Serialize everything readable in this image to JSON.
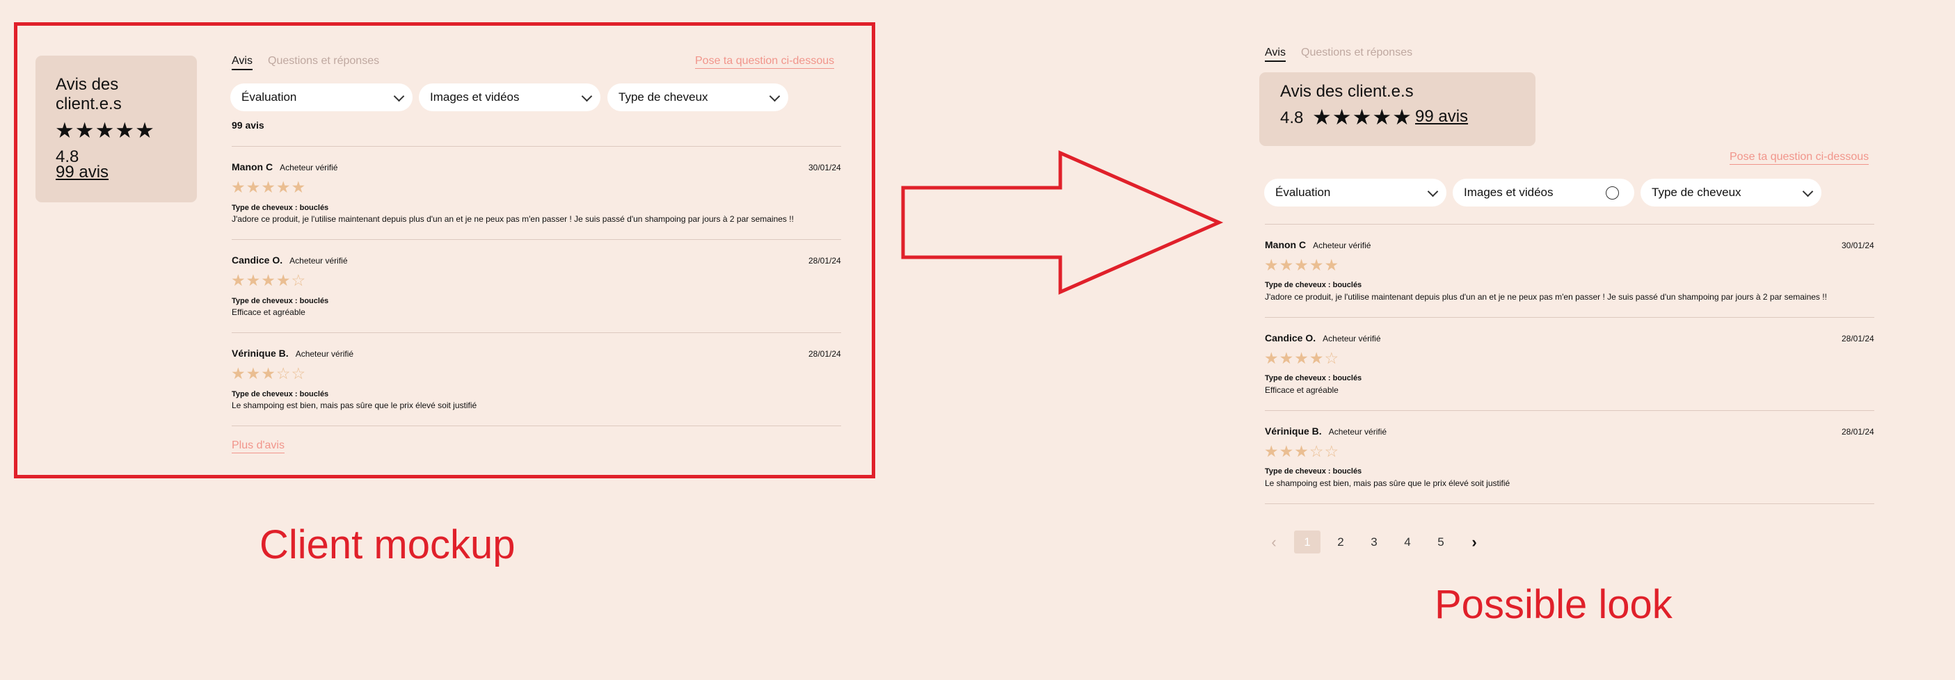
{
  "mockup": {
    "summary": {
      "title_line1": "Avis des",
      "title_line2": "client.e.s",
      "stars": "★★★★★",
      "rating": "4.8",
      "count": "99 avis"
    },
    "tabs": [
      {
        "label": "Avis"
      },
      {
        "label": "Questions et réponses"
      }
    ],
    "ask_link": "Pose ta question ci-dessous",
    "filters": [
      {
        "label": "Évaluation"
      },
      {
        "label": "Images et vidéos"
      },
      {
        "label": "Type de cheveux"
      }
    ],
    "review_count": "99 avis",
    "reviews": [
      {
        "name": "Manon C",
        "verified": "Acheteur vérifié",
        "date": "30/01/24",
        "filled": "★★★★★",
        "empty": "",
        "rating": 5,
        "hair_type": "Type de cheveux : bouclés",
        "text": "J'adore ce produit, je l'utilise maintenant depuis plus d'un an et je ne peux pas m'en passer ! Je suis passé d'un shampoing par jours à 2 par semaines !!"
      },
      {
        "name": "Candice O.",
        "verified": "Acheteur vérifié",
        "date": "28/01/24",
        "filled": "★★★★",
        "empty": "☆",
        "rating": 4,
        "hair_type": "Type de cheveux : bouclés",
        "text": "Efficace et agréable"
      },
      {
        "name": "Vérinique B.",
        "verified": "Acheteur vérifié",
        "date": "28/01/24",
        "filled": "★★★",
        "empty": "☆☆",
        "rating": 3,
        "hair_type": "Type de cheveux : bouclés",
        "text": "Le shampoing est bien, mais pas sûre que le prix élevé soit justifié"
      }
    ],
    "more_link": "Plus d'avis",
    "caption": "Client mockup"
  },
  "possible": {
    "tabs": [
      {
        "label": "Avis"
      },
      {
        "label": "Questions et réponses"
      }
    ],
    "summary": {
      "title": "Avis des client.e.s",
      "rating": "4.8",
      "stars": "★★★★★",
      "count": "99 avis"
    },
    "ask_link": "Pose ta question ci-dessous",
    "filters": [
      {
        "label": "Évaluation"
      },
      {
        "label": "Images et vidéos"
      },
      {
        "label": "Type de cheveux"
      }
    ],
    "reviews": [
      {
        "name": "Manon C",
        "verified": "Acheteur vérifié",
        "date": "30/01/24",
        "filled": "★★★★★",
        "empty": "",
        "rating": 5,
        "hair_type": "Type de cheveux : bouclés",
        "text": "J'adore ce produit, je l'utilise maintenant depuis plus d'un an et je ne peux pas m'en passer ! Je suis passé d'un shampoing par jours à 2 par semaines !!"
      },
      {
        "name": "Candice O.",
        "verified": "Acheteur vérifié",
        "date": "28/01/24",
        "filled": "★★★★",
        "empty": "☆",
        "rating": 4,
        "hair_type": "Type de cheveux : bouclés",
        "text": "Efficace et agréable"
      },
      {
        "name": "Vérinique B.",
        "verified": "Acheteur vérifié",
        "date": "28/01/24",
        "filled": "★★★",
        "empty": "☆☆",
        "rating": 3,
        "hair_type": "Type de cheveux : bouclés",
        "text": "Le shampoing est bien, mais pas sûre que le prix élevé soit justifié"
      }
    ],
    "pagination": {
      "prev": "‹",
      "pages": [
        "1",
        "2",
        "3",
        "4",
        "5"
      ],
      "current": "1",
      "next": "›"
    },
    "caption": "Possible look"
  },
  "colors": {
    "background": "#f9ebe3",
    "card": "#ead6ca",
    "accent_pink": "#f1958b",
    "star_gold": "#eabe92",
    "annotation_red": "#e0202a"
  },
  "icons": [
    "chevron-down-icon",
    "radio-circle-icon",
    "arrow-right-icon",
    "star-icon",
    "chevron-left-icon",
    "chevron-right-icon"
  ]
}
